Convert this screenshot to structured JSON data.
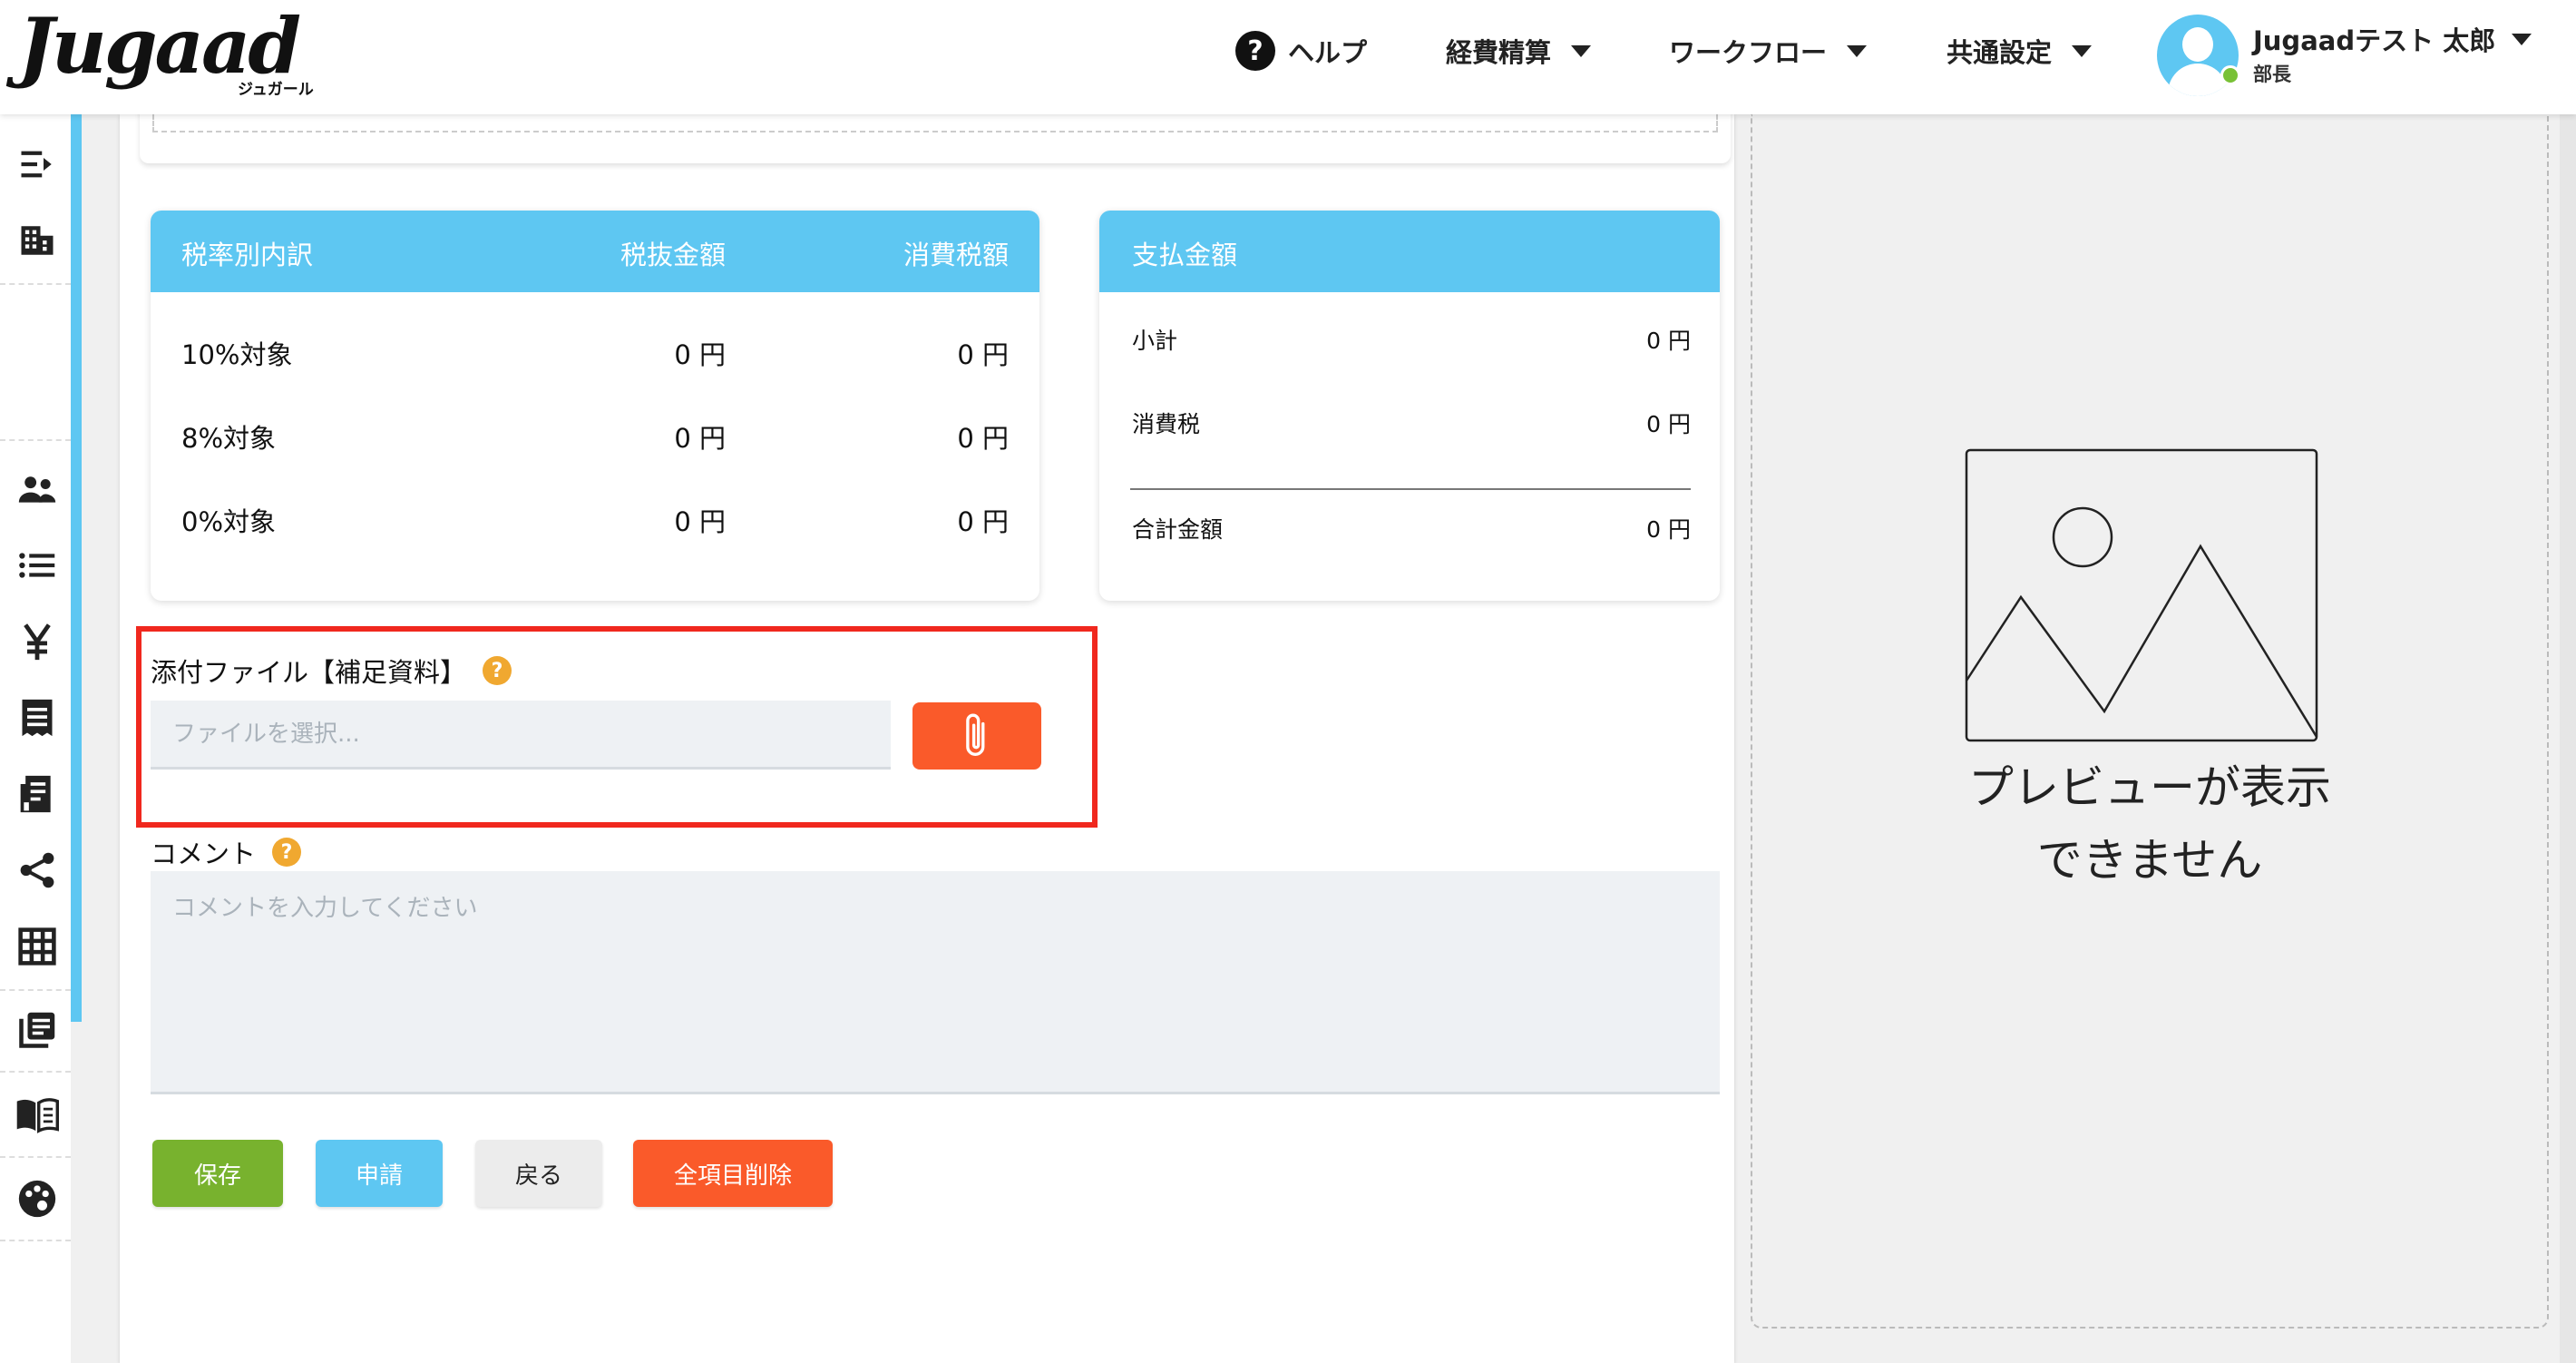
{
  "header": {
    "logo_text": "Jugaad",
    "logo_sub": "ジュガール",
    "help_label": "ヘルプ",
    "nav": [
      {
        "label": "経費精算"
      },
      {
        "label": "ワークフロー"
      },
      {
        "label": "共通設定"
      }
    ],
    "user": {
      "name": "Jugaadテスト 太郎",
      "role": "部長"
    }
  },
  "sidebar": {
    "icons": [
      "menu-collapse-icon",
      "building-icon",
      "users-icon",
      "list-icon",
      "yen-icon",
      "receipt-icon",
      "invoice-icon",
      "share-icon",
      "grid-icon",
      "library-icon",
      "book-icon",
      "palette-icon"
    ]
  },
  "tax_breakdown": {
    "headers": [
      "税率別内訳",
      "税抜金額",
      "消費税額"
    ],
    "rows": [
      {
        "label": "10%対象",
        "net": "0 円",
        "tax": "0 円"
      },
      {
        "label": "8%対象",
        "net": "0 円",
        "tax": "0 円"
      },
      {
        "label": "0%対象",
        "net": "0 円",
        "tax": "0 円"
      }
    ]
  },
  "payment": {
    "title": "支払金額",
    "rows": [
      {
        "label": "小計",
        "value": "0 円"
      },
      {
        "label": "消費税",
        "value": "0 円"
      },
      {
        "label": "合計金額",
        "value": "0 円"
      }
    ]
  },
  "attachment": {
    "label": "添付ファイル【補足資料】",
    "help": "?",
    "placeholder": "ファイルを選択..."
  },
  "comment": {
    "label": "コメント",
    "help": "?",
    "placeholder": "コメントを入力してください"
  },
  "buttons": {
    "save": "保存",
    "apply": "申請",
    "back": "戻る",
    "clear_all": "全項目削除"
  },
  "preview": {
    "line1": "プレビューが表示",
    "line2": "できません"
  },
  "colors": {
    "accent": "#5ec7f2",
    "save": "#78b22e",
    "apply": "#5ec7f2",
    "danger": "#fa5a2a",
    "highlight": "#f0281e"
  }
}
